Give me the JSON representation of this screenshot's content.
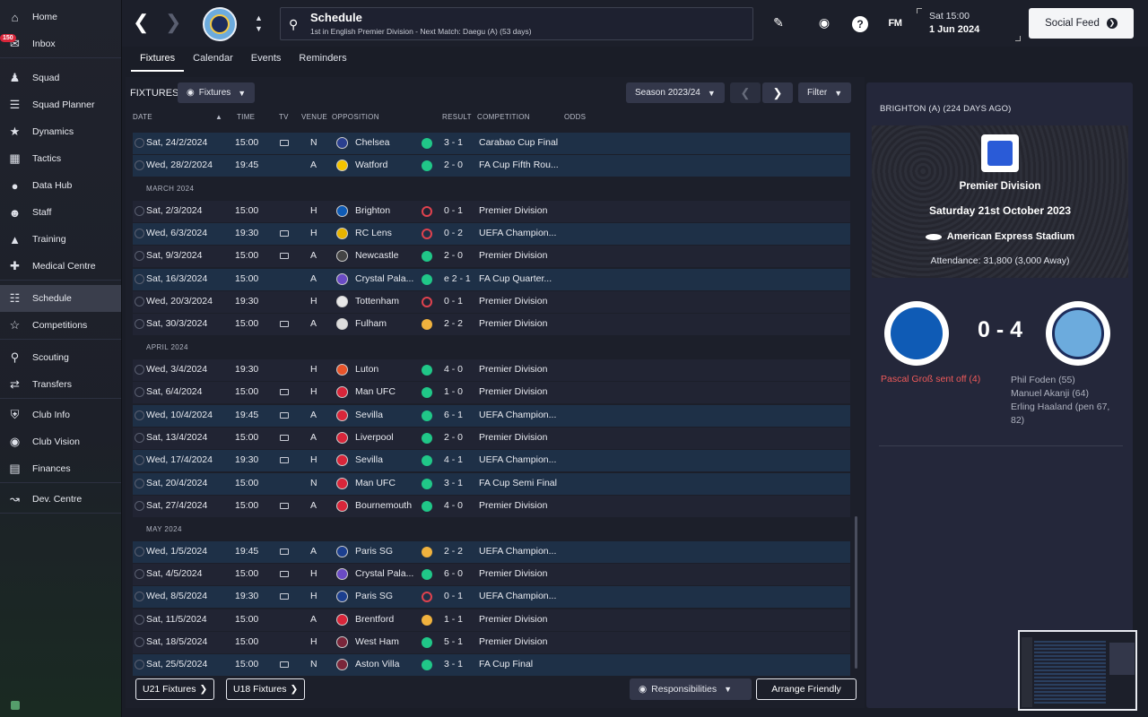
{
  "sidebar": {
    "items": [
      {
        "label": "Home",
        "icon": "home-icon"
      },
      {
        "label": "Inbox",
        "icon": "inbox-icon",
        "badge": "150"
      },
      {
        "label": "Squad",
        "icon": "squad-icon"
      },
      {
        "label": "Squad Planner",
        "icon": "planner-icon"
      },
      {
        "label": "Dynamics",
        "icon": "dynamics-icon"
      },
      {
        "label": "Tactics",
        "icon": "tactics-icon"
      },
      {
        "label": "Data Hub",
        "icon": "data-hub-icon"
      },
      {
        "label": "Staff",
        "icon": "staff-icon"
      },
      {
        "label": "Training",
        "icon": "training-icon"
      },
      {
        "label": "Medical Centre",
        "icon": "medical-icon"
      },
      {
        "label": "Schedule",
        "icon": "schedule-icon"
      },
      {
        "label": "Competitions",
        "icon": "trophy-icon"
      },
      {
        "label": "Scouting",
        "icon": "scouting-icon"
      },
      {
        "label": "Transfers",
        "icon": "transfers-icon"
      },
      {
        "label": "Club Info",
        "icon": "shield-icon"
      },
      {
        "label": "Club Vision",
        "icon": "vision-icon"
      },
      {
        "label": "Finances",
        "icon": "finances-icon"
      },
      {
        "label": "Dev. Centre",
        "icon": "dev-centre-icon"
      }
    ]
  },
  "header": {
    "title": "Schedule",
    "subtitle": "1st in English Premier Division - Next Match: Daegu (A) (53 days)",
    "time": "Sat 15:00",
    "date": "1 Jun 2024",
    "social_feed": "Social Feed",
    "fm_logo": "FM"
  },
  "tabs": [
    "Fixtures",
    "Calendar",
    "Events",
    "Reminders"
  ],
  "fixtures": {
    "title": "FIXTURES",
    "view_dropdown": "Fixtures",
    "season_dropdown": "Season 2023/24",
    "filter_label": "Filter",
    "columns": [
      "DATE",
      "TIME",
      "TV",
      "VENUE",
      "OPPOSITION",
      "RESULT",
      "COMPETITION",
      "ODDS"
    ],
    "months": [
      "MARCH 2024",
      "APRIL 2024",
      "MAY 2024"
    ],
    "rows": [
      {
        "date": "Sat, 24/2/2024",
        "time": "15:00",
        "tv": true,
        "venue": "N",
        "opp": "Chelsea",
        "res": "win",
        "score": "3 - 1",
        "comp": "Carabao Cup Final",
        "hl": true,
        "color": "#2a3f8f"
      },
      {
        "date": "Wed, 28/2/2024",
        "time": "19:45",
        "tv": false,
        "venue": "A",
        "opp": "Watford",
        "res": "win",
        "score": "2 - 0",
        "comp": "FA Cup Fifth Rou...",
        "hl": true,
        "color": "#f5c400"
      },
      {
        "date": "Sat, 2/3/2024",
        "time": "15:00",
        "tv": false,
        "venue": "H",
        "opp": "Brighton",
        "res": "loss",
        "score": "0 - 1",
        "comp": "Premier Division",
        "hl": false,
        "color": "#0f5bb5"
      },
      {
        "date": "Wed, 6/3/2024",
        "time": "19:30",
        "tv": true,
        "venue": "H",
        "opp": "RC Lens",
        "res": "loss",
        "score": "0 - 2",
        "comp": "UEFA Champion...",
        "hl": true,
        "color": "#e8b400"
      },
      {
        "date": "Sat, 9/3/2024",
        "time": "15:00",
        "tv": true,
        "venue": "A",
        "opp": "Newcastle",
        "res": "win",
        "score": "2 - 0",
        "comp": "Premier Division",
        "hl": false,
        "color": "#444444"
      },
      {
        "date": "Sat, 16/3/2024",
        "time": "15:00",
        "tv": false,
        "venue": "A",
        "opp": "Crystal Pala...",
        "res": "win",
        "score": "e 2 - 1",
        "comp": "FA Cup Quarter...",
        "hl": true,
        "color": "#6a4bc4"
      },
      {
        "date": "Wed, 20/3/2024",
        "time": "19:30",
        "tv": false,
        "venue": "H",
        "opp": "Tottenham",
        "res": "loss",
        "score": "0 - 1",
        "comp": "Premier Division",
        "hl": false,
        "color": "#e8e8e8"
      },
      {
        "date": "Sat, 30/3/2024",
        "time": "15:00",
        "tv": true,
        "venue": "A",
        "opp": "Fulham",
        "res": "draw",
        "score": "2 - 2",
        "comp": "Premier Division",
        "hl": false,
        "color": "#dddddd"
      },
      {
        "date": "Wed, 3/4/2024",
        "time": "19:30",
        "tv": false,
        "venue": "H",
        "opp": "Luton",
        "res": "win",
        "score": "4 - 0",
        "comp": "Premier Division",
        "hl": false,
        "color": "#e8542a"
      },
      {
        "date": "Sat, 6/4/2024",
        "time": "15:00",
        "tv": true,
        "venue": "H",
        "opp": "Man UFC",
        "res": "win",
        "score": "1 - 0",
        "comp": "Premier Division",
        "hl": false,
        "color": "#d8263a"
      },
      {
        "date": "Wed, 10/4/2024",
        "time": "19:45",
        "tv": true,
        "venue": "A",
        "opp": "Sevilla",
        "res": "win",
        "score": "6 - 1",
        "comp": "UEFA Champion...",
        "hl": true,
        "color": "#d8263a"
      },
      {
        "date": "Sat, 13/4/2024",
        "time": "15:00",
        "tv": true,
        "venue": "A",
        "opp": "Liverpool",
        "res": "win",
        "score": "2 - 0",
        "comp": "Premier Division",
        "hl": false,
        "color": "#d8263a"
      },
      {
        "date": "Wed, 17/4/2024",
        "time": "19:30",
        "tv": true,
        "venue": "H",
        "opp": "Sevilla",
        "res": "win",
        "score": "4 - 1",
        "comp": "UEFA Champion...",
        "hl": true,
        "color": "#d8263a"
      },
      {
        "date": "Sat, 20/4/2024",
        "time": "15:00",
        "tv": false,
        "venue": "N",
        "opp": "Man UFC",
        "res": "win",
        "score": "3 - 1",
        "comp": "FA Cup Semi Final",
        "hl": true,
        "color": "#d8263a"
      },
      {
        "date": "Sat, 27/4/2024",
        "time": "15:00",
        "tv": true,
        "venue": "A",
        "opp": "Bournemouth",
        "res": "win",
        "score": "4 - 0",
        "comp": "Premier Division",
        "hl": false,
        "color": "#d8263a"
      },
      {
        "date": "Wed, 1/5/2024",
        "time": "19:45",
        "tv": true,
        "venue": "A",
        "opp": "Paris SG",
        "res": "draw",
        "score": "2 - 2",
        "comp": "UEFA Champion...",
        "hl": true,
        "color": "#1c3f8f"
      },
      {
        "date": "Sat, 4/5/2024",
        "time": "15:00",
        "tv": true,
        "venue": "H",
        "opp": "Crystal Pala...",
        "res": "win",
        "score": "6 - 0",
        "comp": "Premier Division",
        "hl": false,
        "color": "#6a4bc4"
      },
      {
        "date": "Wed, 8/5/2024",
        "time": "19:30",
        "tv": true,
        "venue": "H",
        "opp": "Paris SG",
        "res": "loss",
        "score": "0 - 1",
        "comp": "UEFA Champion...",
        "hl": true,
        "color": "#1c3f8f"
      },
      {
        "date": "Sat, 11/5/2024",
        "time": "15:00",
        "tv": false,
        "venue": "A",
        "opp": "Brentford",
        "res": "draw",
        "score": "1 - 1",
        "comp": "Premier Division",
        "hl": false,
        "color": "#d8263a"
      },
      {
        "date": "Sat, 18/5/2024",
        "time": "15:00",
        "tv": false,
        "venue": "H",
        "opp": "West Ham",
        "res": "win",
        "score": "5 - 1",
        "comp": "Premier Division",
        "hl": false,
        "color": "#7a263a"
      },
      {
        "date": "Sat, 25/5/2024",
        "time": "15:00",
        "tv": true,
        "venue": "N",
        "opp": "Aston Villa",
        "res": "win",
        "score": "3 - 1",
        "comp": "FA Cup Final",
        "hl": true,
        "color": "#7a263a"
      }
    ],
    "u21_button": "U21 Fixtures",
    "u18_button": "U18 Fixtures",
    "responsibilities_button": "Responsibilities",
    "arrange_friendly_button": "Arrange Friendly"
  },
  "match_panel": {
    "header": "BRIGHTON (A) (224 DAYS AGO)",
    "competition": "Premier Division",
    "date": "Saturday 21st October 2023",
    "venue": "American Express Stadium",
    "attendance": "Attendance: 31,800 (3,000 Away)",
    "score": "0 - 4",
    "home_event": "Pascal Groß sent off (4)",
    "away_scorers": [
      "Phil Foden (55)",
      "Manuel Akanji (64)",
      "Erling Haaland (pen 67,",
      "82)"
    ]
  }
}
